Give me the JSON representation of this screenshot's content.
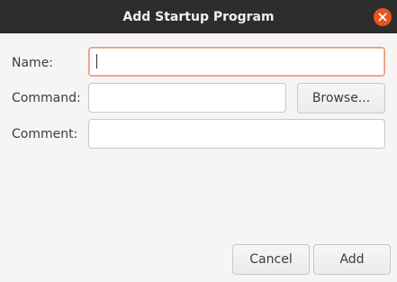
{
  "window": {
    "title": "Add Startup Program",
    "close_icon": "close-icon"
  },
  "form": {
    "name_label": "Name:",
    "name_value": "",
    "command_label": "Command:",
    "command_value": "",
    "browse_label": "Browse...",
    "comment_label": "Comment:",
    "comment_value": ""
  },
  "footer": {
    "cancel_label": "Cancel",
    "add_label": "Add"
  },
  "colors": {
    "titlebar": "#2d2d2d",
    "close_button": "#e95420",
    "focus_border": "#e9967a",
    "background": "#f6f5f4"
  }
}
